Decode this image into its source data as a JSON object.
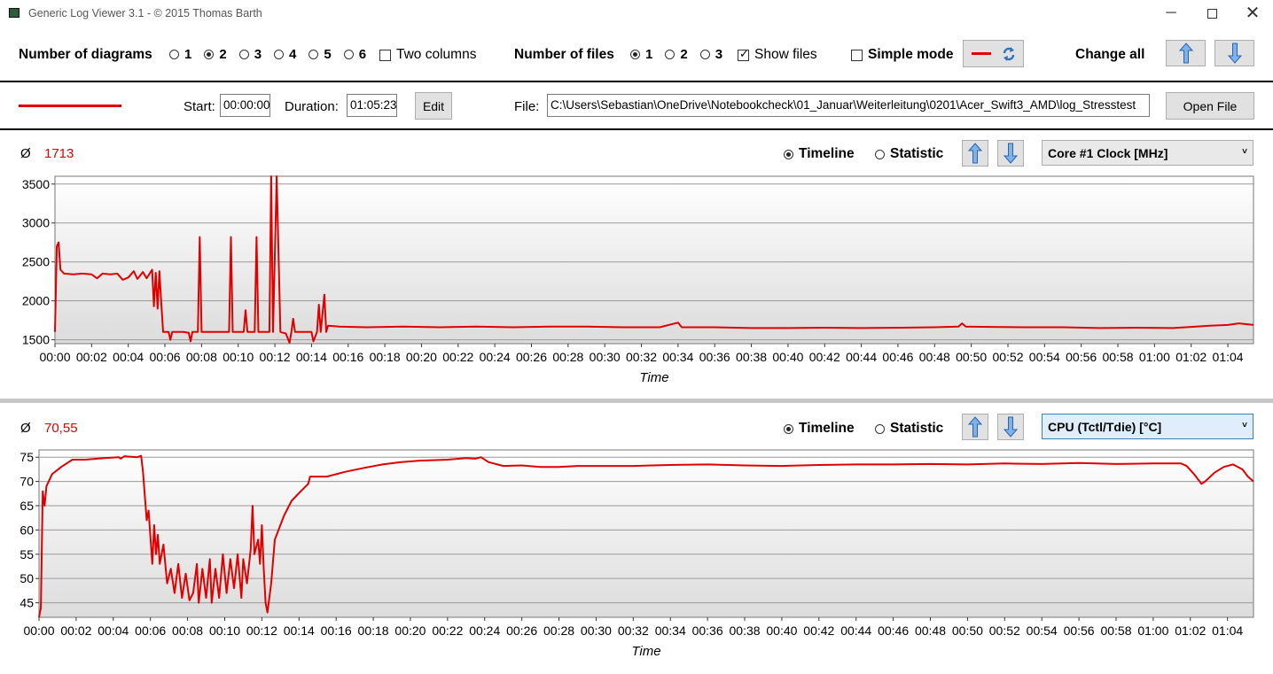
{
  "window": {
    "title": "Generic Log Viewer 3.1 - © 2015 Thomas Barth",
    "minimize_glyph": "─",
    "close_glyph": "✕"
  },
  "toolbar": {
    "num_diagrams_label": "Number of diagrams",
    "diagram_options": [
      "1",
      "2",
      "3",
      "4",
      "5",
      "6"
    ],
    "diagram_selected": "2",
    "two_columns_label": "Two columns",
    "two_columns_checked": false,
    "num_files_label": "Number of files",
    "file_options": [
      "1",
      "2",
      "3"
    ],
    "file_selected": "1",
    "show_files_label": "Show files",
    "show_files_checked": true,
    "simple_mode_label": "Simple mode",
    "simple_mode_checked": false,
    "change_all_label": "Change all"
  },
  "file": {
    "start_label": "Start:",
    "start_value": "00:00:00",
    "duration_label": "Duration:",
    "duration_value": "01:05:23",
    "edit_label": "Edit",
    "file_label": "File:",
    "path": "C:\\Users\\Sebastian\\OneDrive\\Notebookcheck\\01_Januar\\Weiterleitung\\0201\\Acer_Swift3_AMD\\log_Stresstest",
    "open_label": "Open File",
    "series_color": "#e00000"
  },
  "panels": [
    {
      "avg_symbol": "Ø",
      "avg_value": "1713",
      "timeline_label": "Timeline",
      "statistic_label": "Statistic",
      "mode": "Timeline",
      "sensor": "Core #1 Clock [MHz]"
    },
    {
      "avg_symbol": "Ø",
      "avg_value": "70,55",
      "timeline_label": "Timeline",
      "statistic_label": "Statistic",
      "mode": "Timeline",
      "sensor": "CPU (Tctl/Tdie) [°C]"
    }
  ],
  "chart_data": [
    {
      "type": "line",
      "xlabel": "Time",
      "ylabel": "",
      "x_unit": "minutes",
      "x_ticks": [
        "00:00",
        "00:02",
        "00:04",
        "00:06",
        "00:08",
        "00:10",
        "00:12",
        "00:14",
        "00:16",
        "00:18",
        "00:20",
        "00:22",
        "00:24",
        "00:26",
        "00:28",
        "00:30",
        "00:32",
        "00:34",
        "00:36",
        "00:38",
        "00:40",
        "00:42",
        "00:44",
        "00:46",
        "00:48",
        "00:50",
        "00:52",
        "00:54",
        "00:56",
        "00:58",
        "01:00",
        "01:02",
        "01:04"
      ],
      "y_ticks": [
        1500,
        2000,
        2500,
        3000,
        3500
      ],
      "ylim": [
        1450,
        3600
      ],
      "xlim": [
        0,
        65.4
      ],
      "grid": true,
      "series": [
        {
          "color": "#e00000",
          "points": [
            [
              0,
              1600
            ],
            [
              0.1,
              2700
            ],
            [
              0.2,
              2750
            ],
            [
              0.3,
              2400
            ],
            [
              0.5,
              2350
            ],
            [
              1,
              2340
            ],
            [
              1.5,
              2350
            ],
            [
              2,
              2340
            ],
            [
              2.3,
              2290
            ],
            [
              2.6,
              2350
            ],
            [
              3,
              2340
            ],
            [
              3.4,
              2350
            ],
            [
              3.7,
              2270
            ],
            [
              4,
              2300
            ],
            [
              4.3,
              2380
            ],
            [
              4.5,
              2280
            ],
            [
              4.8,
              2370
            ],
            [
              5,
              2290
            ],
            [
              5.3,
              2400
            ],
            [
              5.4,
              1930
            ],
            [
              5.5,
              2360
            ],
            [
              5.6,
              1900
            ],
            [
              5.7,
              2380
            ],
            [
              5.8,
              1980
            ],
            [
              5.9,
              1600
            ],
            [
              6.2,
              1600
            ],
            [
              6.3,
              1500
            ],
            [
              6.4,
              1600
            ],
            [
              7,
              1600
            ],
            [
              7.3,
              1590
            ],
            [
              7.4,
              1480
            ],
            [
              7.5,
              1600
            ],
            [
              7.8,
              1600
            ],
            [
              7.9,
              2820
            ],
            [
              8,
              1600
            ],
            [
              9.5,
              1600
            ],
            [
              9.6,
              2820
            ],
            [
              9.7,
              1600
            ],
            [
              10.3,
              1600
            ],
            [
              10.4,
              1880
            ],
            [
              10.5,
              1600
            ],
            [
              10.9,
              1600
            ],
            [
              11,
              2820
            ],
            [
              11.1,
              1600
            ],
            [
              11.7,
              1600
            ],
            [
              11.8,
              3600
            ],
            [
              11.9,
              1600
            ],
            [
              12.1,
              3600
            ],
            [
              12.3,
              1600
            ],
            [
              12.6,
              1580
            ],
            [
              12.8,
              1460
            ],
            [
              12.9,
              1600
            ],
            [
              13,
              1770
            ],
            [
              13.1,
              1600
            ],
            [
              14,
              1600
            ],
            [
              14.1,
              1480
            ],
            [
              14.3,
              1600
            ],
            [
              14.4,
              1950
            ],
            [
              14.5,
              1600
            ],
            [
              14.7,
              2080
            ],
            [
              14.8,
              1600
            ],
            [
              14.9,
              1680
            ],
            [
              15.5,
              1670
            ],
            [
              17,
              1660
            ],
            [
              19,
              1670
            ],
            [
              21,
              1660
            ],
            [
              23,
              1670
            ],
            [
              25,
              1660
            ],
            [
              27,
              1670
            ],
            [
              29,
              1670
            ],
            [
              31,
              1660
            ],
            [
              33,
              1660
            ],
            [
              34,
              1720
            ],
            [
              34.2,
              1660
            ],
            [
              36,
              1660
            ],
            [
              38,
              1650
            ],
            [
              40,
              1650
            ],
            [
              42,
              1655
            ],
            [
              44,
              1650
            ],
            [
              46,
              1655
            ],
            [
              48,
              1660
            ],
            [
              49.3,
              1670
            ],
            [
              49.5,
              1710
            ],
            [
              49.7,
              1670
            ],
            [
              51,
              1665
            ],
            [
              53,
              1660
            ],
            [
              55,
              1660
            ],
            [
              57,
              1650
            ],
            [
              59,
              1655
            ],
            [
              61,
              1650
            ],
            [
              62,
              1665
            ],
            [
              63,
              1680
            ],
            [
              64,
              1690
            ],
            [
              64.6,
              1710
            ],
            [
              65.4,
              1690
            ]
          ]
        }
      ]
    },
    {
      "type": "line",
      "xlabel": "Time",
      "ylabel": "",
      "x_unit": "minutes",
      "x_ticks": [
        "00:00",
        "00:02",
        "00:04",
        "00:06",
        "00:08",
        "00:10",
        "00:12",
        "00:14",
        "00:16",
        "00:18",
        "00:20",
        "00:22",
        "00:24",
        "00:26",
        "00:28",
        "00:30",
        "00:32",
        "00:34",
        "00:36",
        "00:38",
        "00:40",
        "00:42",
        "00:44",
        "00:46",
        "00:48",
        "00:50",
        "00:52",
        "00:54",
        "00:56",
        "00:58",
        "01:00",
        "01:02",
        "01:04"
      ],
      "y_ticks": [
        45,
        50,
        55,
        60,
        65,
        70,
        75
      ],
      "ylim": [
        42,
        76.5
      ],
      "xlim": [
        0,
        65.4
      ],
      "grid": true,
      "series": [
        {
          "color": "#e00000",
          "points": [
            [
              0,
              42
            ],
            [
              0.1,
              44
            ],
            [
              0.2,
              68
            ],
            [
              0.3,
              65
            ],
            [
              0.4,
              69
            ],
            [
              0.7,
              71.5
            ],
            [
              1.2,
              73
            ],
            [
              1.8,
              74.5
            ],
            [
              2.5,
              74.5
            ],
            [
              3.5,
              74.8
            ],
            [
              4.3,
              75
            ],
            [
              4.4,
              74.7
            ],
            [
              4.6,
              75.2
            ],
            [
              5.3,
              75
            ],
            [
              5.5,
              75.3
            ],
            [
              5.6,
              72
            ],
            [
              5.8,
              62
            ],
            [
              5.9,
              64
            ],
            [
              6.1,
              53
            ],
            [
              6.2,
              61
            ],
            [
              6.3,
              55
            ],
            [
              6.4,
              59
            ],
            [
              6.5,
              53
            ],
            [
              6.7,
              57
            ],
            [
              6.9,
              49
            ],
            [
              7.1,
              52
            ],
            [
              7.3,
              47
            ],
            [
              7.5,
              53
            ],
            [
              7.7,
              46
            ],
            [
              7.9,
              51
            ],
            [
              8.1,
              45.5
            ],
            [
              8.3,
              47
            ],
            [
              8.5,
              53
            ],
            [
              8.6,
              45
            ],
            [
              8.8,
              52
            ],
            [
              9,
              46
            ],
            [
              9.2,
              54
            ],
            [
              9.3,
              45
            ],
            [
              9.5,
              52
            ],
            [
              9.7,
              46
            ],
            [
              9.9,
              55
            ],
            [
              10.1,
              47
            ],
            [
              10.3,
              54
            ],
            [
              10.5,
              48
            ],
            [
              10.7,
              55
            ],
            [
              10.9,
              46
            ],
            [
              11,
              54
            ],
            [
              11.2,
              49
            ],
            [
              11.4,
              56
            ],
            [
              11.5,
              65
            ],
            [
              11.6,
              55
            ],
            [
              11.8,
              58
            ],
            [
              11.9,
              53
            ],
            [
              12,
              61
            ],
            [
              12.1,
              52
            ],
            [
              12.2,
              45
            ],
            [
              12.3,
              43
            ],
            [
              12.5,
              49
            ],
            [
              12.7,
              58
            ],
            [
              12.9,
              60
            ],
            [
              13.2,
              63
            ],
            [
              13.6,
              66
            ],
            [
              14.1,
              68
            ],
            [
              14.5,
              69.5
            ],
            [
              14.6,
              71
            ],
            [
              15.5,
              71
            ],
            [
              16.5,
              72
            ],
            [
              17.5,
              72.8
            ],
            [
              18.5,
              73.5
            ],
            [
              19.5,
              74
            ],
            [
              20.5,
              74.3
            ],
            [
              22,
              74.5
            ],
            [
              23,
              74.8
            ],
            [
              23.5,
              74.7
            ],
            [
              23.8,
              75
            ],
            [
              24.2,
              74
            ],
            [
              25,
              73.2
            ],
            [
              26,
              73.3
            ],
            [
              27,
              73
            ],
            [
              28,
              73
            ],
            [
              29,
              73.2
            ],
            [
              30,
              73.2
            ],
            [
              31,
              73.2
            ],
            [
              32,
              73.2
            ],
            [
              33,
              73.3
            ],
            [
              34,
              73.4
            ],
            [
              36,
              73.5
            ],
            [
              38,
              73.3
            ],
            [
              40,
              73.2
            ],
            [
              42,
              73.4
            ],
            [
              44,
              73.5
            ],
            [
              46,
              73.5
            ],
            [
              48,
              73.6
            ],
            [
              50,
              73.5
            ],
            [
              52,
              73.7
            ],
            [
              54,
              73.6
            ],
            [
              56,
              73.8
            ],
            [
              58,
              73.6
            ],
            [
              60,
              73.7
            ],
            [
              61.5,
              73.7
            ],
            [
              61.8,
              73.2
            ],
            [
              62.2,
              71.5
            ],
            [
              62.6,
              69.5
            ],
            [
              62.8,
              70
            ],
            [
              63.3,
              71.8
            ],
            [
              63.8,
              73
            ],
            [
              64.3,
              73.5
            ],
            [
              64.8,
              72.5
            ],
            [
              65.1,
              71
            ],
            [
              65.4,
              70
            ]
          ]
        }
      ]
    }
  ]
}
